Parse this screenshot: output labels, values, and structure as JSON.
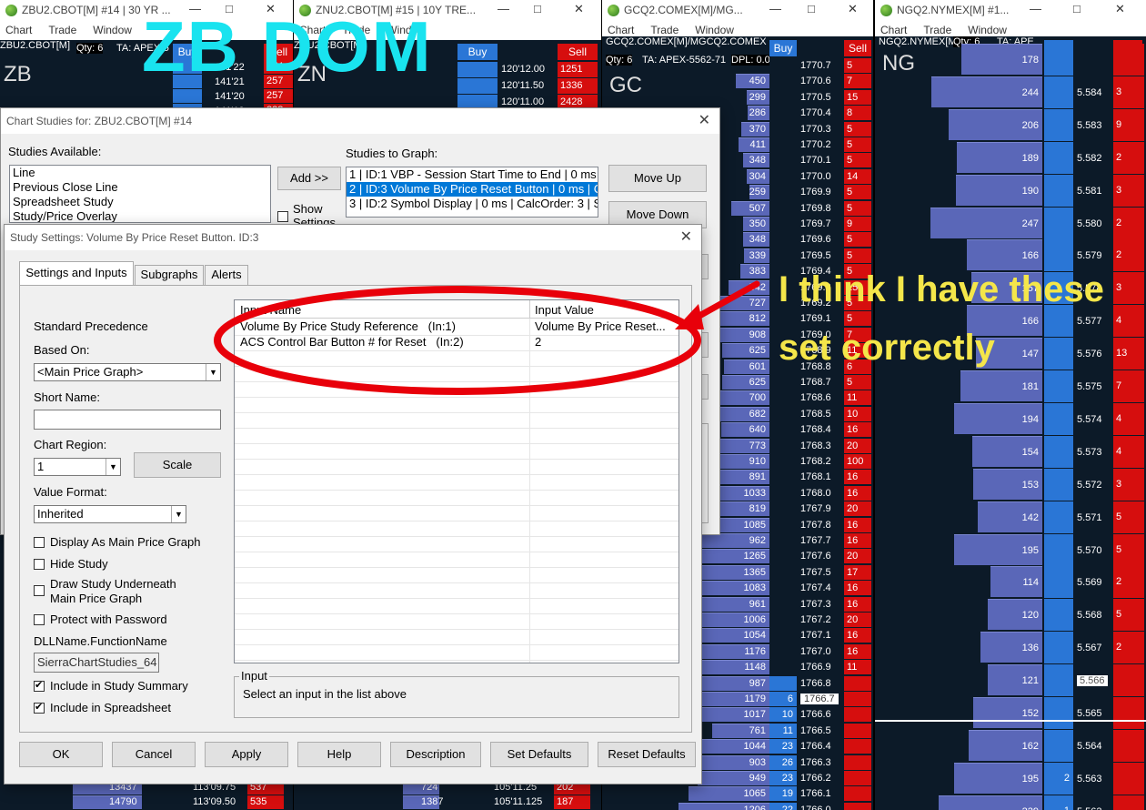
{
  "windows": {
    "zb": {
      "title": "ZBU2.CBOT[M]  #14 | 30 YR ...",
      "symbol": "ZB",
      "sub": "ZBU2.CBOT[M]",
      "qty": "Qty: 6",
      "ta": "TA: APEX-5",
      "buy": "Buy",
      "sell": "Sell",
      "rows": [
        {
          "p": "141'22",
          "s": "274"
        },
        {
          "p": "141'21",
          "s": "257"
        },
        {
          "p": "141'20",
          "s": "257"
        },
        {
          "p": "141'19",
          "s": "228"
        }
      ],
      "bottom": [
        {
          "v": "13437",
          "p": "113'09.75",
          "s": "537"
        },
        {
          "v": "14790",
          "p": "113'09.50",
          "s": "535"
        }
      ]
    },
    "zn": {
      "title": "ZNU2.CBOT[M]  #15 | 10Y TRE...",
      "symbol": "ZN",
      "sub": "ZNU2.CBOT[M]",
      "buy": "Buy",
      "sell": "Sell",
      "rows": [
        {
          "p": "120'12.00",
          "s": "1251"
        },
        {
          "p": "120'11.50",
          "s": "1336"
        },
        {
          "p": "120'11.00",
          "s": "2428"
        }
      ],
      "bottom": [
        {
          "v": "724",
          "p": "105'11.25",
          "s": "202"
        },
        {
          "v": "1387",
          "p": "105'11.125",
          "s": "187"
        }
      ]
    },
    "gc": {
      "title": "GCQ2.COMEX[M]/MG...",
      "symbol": "GC",
      "sub": "GCQ2.COMEX[M]/MGCQ2.COMEX",
      "qty": "Qty: 6",
      "ta": "TA: APEX-5562-71",
      "dpl": "DPL: 0.0",
      "buy": "Buy",
      "sell": "Sell",
      "rows": [
        {
          "v": "",
          "p": "1770.7",
          "s": "5"
        },
        {
          "v": "450",
          "p": "1770.6",
          "s": "7"
        },
        {
          "v": "299",
          "p": "1770.5",
          "s": "15"
        },
        {
          "v": "286",
          "p": "1770.4",
          "s": "8"
        },
        {
          "v": "370",
          "p": "1770.3",
          "s": "5"
        },
        {
          "v": "411",
          "p": "1770.2",
          "s": "5"
        },
        {
          "v": "348",
          "p": "1770.1",
          "s": "5"
        },
        {
          "v": "304",
          "p": "1770.0",
          "s": "14"
        },
        {
          "v": "259",
          "p": "1769.9",
          "s": "5"
        },
        {
          "v": "507",
          "p": "1769.8",
          "s": "5"
        },
        {
          "v": "350",
          "p": "1769.7",
          "s": "9"
        },
        {
          "v": "348",
          "p": "1769.6",
          "s": "5"
        },
        {
          "v": "339",
          "p": "1769.5",
          "s": "5"
        },
        {
          "v": "383",
          "p": "1769.4",
          "s": "5"
        },
        {
          "v": "542",
          "p": "1769.3",
          "s": "15"
        },
        {
          "v": "727",
          "p": "1769.2",
          "s": "5"
        },
        {
          "v": "812",
          "p": "1769.1",
          "s": "5"
        },
        {
          "v": "908",
          "p": "1769.0",
          "s": "7"
        },
        {
          "v": "625",
          "p": "1768.9",
          "s": "11"
        },
        {
          "v": "601",
          "p": "1768.8",
          "s": "6"
        },
        {
          "v": "625",
          "p": "1768.7",
          "s": "5"
        },
        {
          "v": "700",
          "p": "1768.6",
          "s": "11"
        },
        {
          "v": "682",
          "p": "1768.5",
          "s": "10"
        },
        {
          "v": "640",
          "p": "1768.4",
          "s": "16"
        },
        {
          "v": "773",
          "p": "1768.3",
          "s": "20"
        },
        {
          "v": "910",
          "p": "1768.2",
          "s": "100"
        },
        {
          "v": "891",
          "p": "1768.1",
          "s": "16"
        },
        {
          "v": "1033",
          "p": "1768.0",
          "s": "16"
        },
        {
          "v": "819",
          "p": "1767.9",
          "s": "20"
        },
        {
          "v": "1085",
          "p": "1767.8",
          "s": "16"
        },
        {
          "v": "962",
          "p": "1767.7",
          "s": "16"
        },
        {
          "v": "1265",
          "p": "1767.6",
          "s": "20"
        },
        {
          "v": "1365",
          "p": "1767.5",
          "s": "17"
        },
        {
          "v": "1083",
          "p": "1767.4",
          "s": "16"
        },
        {
          "v": "961",
          "p": "1767.3",
          "s": "16"
        },
        {
          "v": "1006",
          "p": "1767.2",
          "s": "20"
        },
        {
          "v": "1054",
          "p": "1767.1",
          "s": "16"
        },
        {
          "v": "1176",
          "p": "1767.0",
          "s": "16"
        },
        {
          "v": "1148",
          "p": "1766.9",
          "s": "11"
        },
        {
          "v": "987",
          "p": "1766.8",
          "s": "",
          "b": ""
        },
        {
          "v": "1179",
          "p": "1766.7",
          "s": "",
          "b": "6"
        },
        {
          "v": "1017",
          "p": "1766.6",
          "s": "",
          "b": "10"
        },
        {
          "v": "761",
          "p": "1766.5",
          "s": "",
          "b": "11"
        },
        {
          "v": "1044",
          "p": "1766.4",
          "s": "",
          "b": "23"
        },
        {
          "v": "903",
          "p": "1766.3",
          "s": "",
          "b": "26"
        },
        {
          "v": "949",
          "p": "1766.2",
          "s": "",
          "b": "23"
        },
        {
          "v": "1065",
          "p": "1766.1",
          "s": "",
          "b": "19"
        },
        {
          "v": "1206",
          "p": "1766.0",
          "s": "",
          "b": "22"
        }
      ]
    },
    "ng": {
      "title": "NGQ2.NYMEX[M]  #1...",
      "symbol": "NG",
      "sub": "NGQ2.NYMEX[M]",
      "qty": "Qty: 6",
      "ta": "TA: APE",
      "buy": "Buy",
      "sell": "Sell",
      "rows": [
        {
          "v": "178",
          "p": "",
          "s": ""
        },
        {
          "v": "244",
          "p": "5.584",
          "s": "3"
        },
        {
          "v": "206",
          "p": "5.583",
          "s": "9"
        },
        {
          "v": "189",
          "p": "5.582",
          "s": "2"
        },
        {
          "v": "190",
          "p": "5.581",
          "s": "3"
        },
        {
          "v": "247",
          "p": "5.580",
          "s": "2"
        },
        {
          "v": "166",
          "p": "5.579",
          "s": "2"
        },
        {
          "v": "157",
          "p": "5.578",
          "s": "3"
        },
        {
          "v": "166",
          "p": "5.577",
          "s": "4"
        },
        {
          "v": "147",
          "p": "5.576",
          "s": "13"
        },
        {
          "v": "181",
          "p": "5.575",
          "s": "7"
        },
        {
          "v": "194",
          "p": "5.574",
          "s": "4"
        },
        {
          "v": "154",
          "p": "5.573",
          "s": "4"
        },
        {
          "v": "153",
          "p": "5.572",
          "s": "3"
        },
        {
          "v": "142",
          "p": "5.571",
          "s": "5"
        },
        {
          "v": "195",
          "p": "5.570",
          "s": "5"
        },
        {
          "v": "114",
          "p": "5.569",
          "s": "2"
        },
        {
          "v": "120",
          "p": "5.568",
          "s": "5"
        },
        {
          "v": "136",
          "p": "5.567",
          "s": "2"
        },
        {
          "v": "121",
          "p": "5.566",
          "s": ""
        },
        {
          "v": "152",
          "p": "5.565",
          "s": ""
        },
        {
          "v": "162",
          "p": "5.564",
          "s": ""
        },
        {
          "v": "195",
          "p": "5.563",
          "s": "",
          "b": "2"
        },
        {
          "v": "229",
          "p": "5.562",
          "s": "",
          "b": "1"
        }
      ]
    },
    "menu": [
      "Chart",
      "Trade",
      "Window"
    ]
  },
  "overlay": {
    "zb_dom": "ZB DOM",
    "note_line1": "I think I have these",
    "note_line2": "set correctly"
  },
  "chart_studies": {
    "title": "Chart Studies for: ZBU2.CBOT[M]  #14",
    "available_label": "Studies Available:",
    "available": [
      "Line",
      "Previous Close Line",
      "Spreadsheet Study",
      "Study/Price Overlay"
    ],
    "add_button": "Add >>",
    "show_settings": "Show Settings",
    "to_graph_label": "Studies to Graph:",
    "to_graph": [
      "1 | ID:1  VBP - Session Start Time to End | 0 ms |",
      "2 | ID:3  Volume By Price Reset Button | 0 ms | C",
      "3 | ID:2  Symbol Display | 0 ms | CalcOrder: 3 | S"
    ],
    "move_up": "Move Up",
    "move_down": "Move Down"
  },
  "study_settings": {
    "title": "Study Settings: Volume By Price Reset Button. ID:3",
    "tabs": [
      "Settings and Inputs",
      "Subgraphs",
      "Alerts"
    ],
    "standard_precedence": "Standard Precedence",
    "based_on_label": "Based On:",
    "based_on_value": "<Main Price Graph>",
    "short_name_label": "Short Name:",
    "short_name_value": "",
    "chart_region_label": "Chart Region:",
    "chart_region_value": "1",
    "scale_button": "Scale",
    "value_format_label": "Value Format:",
    "value_format_value": "Inherited",
    "checkboxes": [
      {
        "label": "Display As Main Price Graph",
        "checked": false
      },
      {
        "label": "Hide Study",
        "checked": false
      },
      {
        "label": "Draw Study Underneath",
        "label2": "Main Price Graph",
        "checked": false
      },
      {
        "label": "Protect with Password",
        "checked": false
      }
    ],
    "dll_label": "DLLName.FunctionName",
    "dll_value": "SierraChartStudies_64",
    "include_summary": "Include in Study Summary",
    "include_spreadsheet": "Include in Spreadsheet",
    "inputs_header_name": "Input Name",
    "inputs_header_value": "Input Value",
    "inputs": [
      {
        "name": "Volume By Price Study Reference   (In:1)",
        "value": "Volume By Price Reset..."
      },
      {
        "name": "ACS Control Bar Button # for Reset   (In:2)",
        "value": "2"
      }
    ],
    "input_group_label": "Input",
    "input_hint": "Select an input in the list above",
    "buttons": {
      "ok": "OK",
      "cancel": "Cancel",
      "apply": "Apply",
      "help": "Help",
      "description": "Description",
      "set_defaults": "Set Defaults",
      "reset_defaults": "Reset Defaults"
    }
  },
  "colors": {
    "annotation_red": "#e8000a",
    "zb_dom_text": "#19e3ef",
    "note_text": "#f4e64a",
    "sell_red": "#d60e0e",
    "buy_blue": "#2a76d6",
    "vbp_bar": "#5a67b8"
  }
}
